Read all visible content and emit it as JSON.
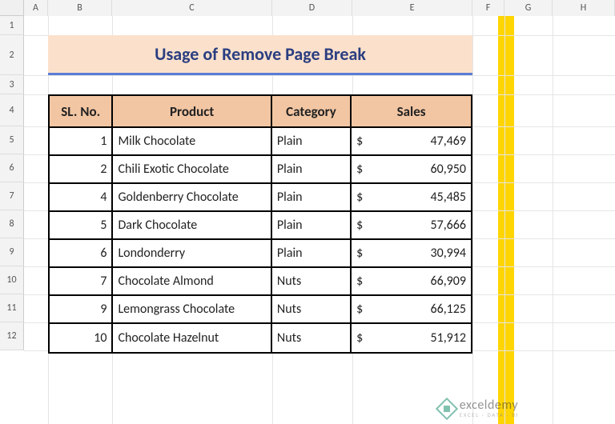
{
  "columns": {
    "corner": 30,
    "A": 30,
    "B": 80,
    "C": 200,
    "D": 100,
    "E": 150,
    "F": 40,
    "G": 60,
    "H": 78
  },
  "row_heights": {
    "1": 24,
    "2": 50,
    "3": 24,
    "4": 40,
    "5": 35,
    "6": 35,
    "7": 35,
    "8": 35,
    "9": 35,
    "10": 35,
    "11": 35,
    "12": 35
  },
  "col_labels": [
    "A",
    "B",
    "C",
    "D",
    "E",
    "F",
    "G",
    "H"
  ],
  "row_labels": [
    "1",
    "2",
    "3",
    "4",
    "5",
    "6",
    "7",
    "8",
    "9",
    "10",
    "11",
    "12"
  ],
  "title": "Usage of Remove Page Break",
  "headers": {
    "sl": "SL. No.",
    "product": "Product",
    "category": "Category",
    "sales": "Sales"
  },
  "currency_symbol": "$",
  "rows": [
    {
      "sl": "1",
      "product": "Milk Chocolate",
      "category": "Plain",
      "sales": "47,469"
    },
    {
      "sl": "2",
      "product": "Chili Exotic Chocolate",
      "category": "Plain",
      "sales": "60,950"
    },
    {
      "sl": "4",
      "product": "Goldenberry Chocolate",
      "category": "Plain",
      "sales": "45,485"
    },
    {
      "sl": "5",
      "product": "Dark Chocolate",
      "category": "Plain",
      "sales": "57,666"
    },
    {
      "sl": "6",
      "product": "Londonderry",
      "category": "Plain",
      "sales": "30,994"
    },
    {
      "sl": "7",
      "product": "Chocolate Almond",
      "category": "Nuts",
      "sales": "66,909"
    },
    {
      "sl": "9",
      "product": "Lemongrass Chocolate",
      "category": "Nuts",
      "sales": "66,125"
    },
    {
      "sl": "10",
      "product": "Chocolate Hazelnut",
      "category": "Nuts",
      "sales": "51,912"
    }
  ],
  "watermark": {
    "main": "exceldemy",
    "sub": "EXCEL · DATA · BI"
  },
  "chart_data": {
    "type": "table",
    "title": "Usage of Remove Page Break",
    "columns": [
      "SL. No.",
      "Product",
      "Category",
      "Sales"
    ],
    "rows": [
      [
        1,
        "Milk Chocolate",
        "Plain",
        47469
      ],
      [
        2,
        "Chili Exotic Chocolate",
        "Plain",
        60950
      ],
      [
        4,
        "Goldenberry Chocolate",
        "Plain",
        45485
      ],
      [
        5,
        "Dark Chocolate",
        "Plain",
        57666
      ],
      [
        6,
        "Londonderry",
        "Plain",
        30994
      ],
      [
        7,
        "Chocolate Almond",
        "Nuts",
        66909
      ],
      [
        9,
        "Lemongrass Chocolate",
        "Nuts",
        66125
      ],
      [
        10,
        "Chocolate Hazelnut",
        "Nuts",
        51912
      ]
    ]
  }
}
